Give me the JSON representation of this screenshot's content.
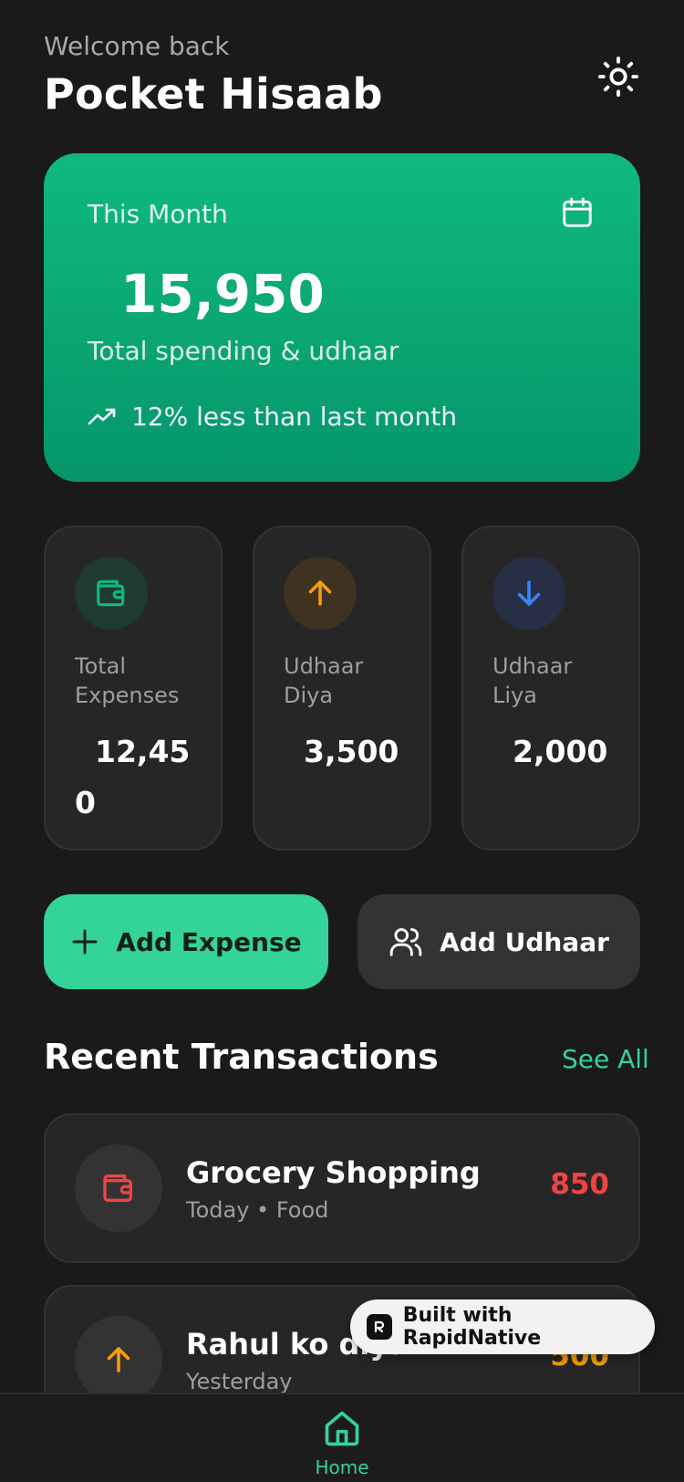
{
  "header": {
    "welcome": "Welcome back",
    "title": "Pocket Hisaab",
    "theme_icon": "sun-icon"
  },
  "summary": {
    "label": "This Month",
    "amount": "15,950",
    "subtitle": "Total spending & udhaar",
    "trend": "12% less than last month",
    "calendar_icon": "calendar-icon",
    "trend_icon": "trending-icon"
  },
  "stats": [
    {
      "label": "Total Expenses",
      "value": "12,450",
      "icon": "wallet-icon",
      "color": "#10b981"
    },
    {
      "label": "Udhaar Diya",
      "value": "3,500",
      "icon": "arrow-up-icon",
      "color": "#f59e0b"
    },
    {
      "label": "Udhaar Liya",
      "value": "2,000",
      "icon": "arrow-down-icon",
      "color": "#3b82f6"
    }
  ],
  "actions": {
    "add_expense": "Add Expense",
    "add_udhaar": "Add Udhaar"
  },
  "recent": {
    "title": "Recent Transactions",
    "see_all": "See All",
    "items": [
      {
        "title": "Grocery Shopping",
        "meta": "Today • Food",
        "amount": "850",
        "icon": "wallet-icon",
        "color": "#ef4444"
      },
      {
        "title": "Rahul ko diya",
        "meta": "Yesterday",
        "amount": "500",
        "icon": "arrow-up-icon",
        "color": "#f59e0b"
      }
    ]
  },
  "badge": {
    "text": "Built with RapidNative"
  },
  "nav": {
    "home": "Home"
  },
  "colors": {
    "accent": "#34d399",
    "background": "#1a1a1a",
    "card": "#262626"
  }
}
